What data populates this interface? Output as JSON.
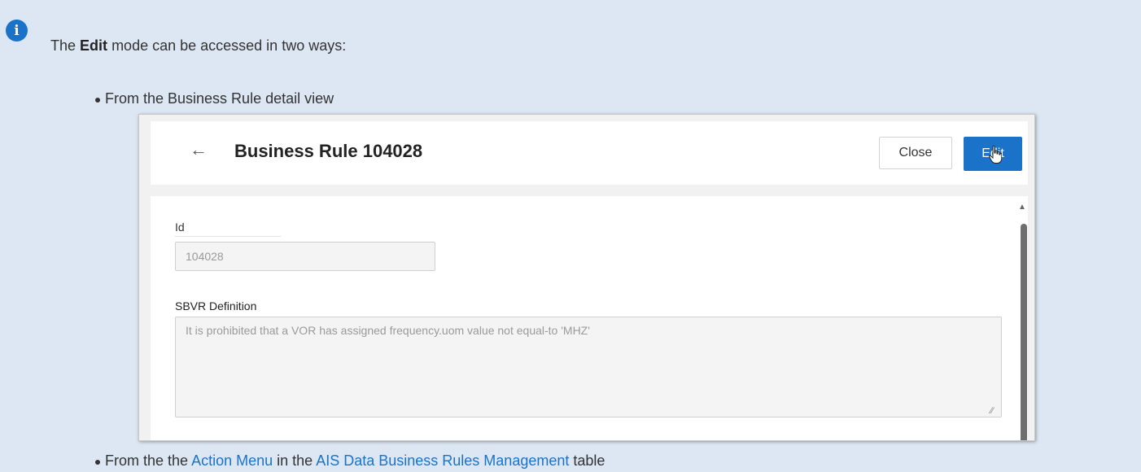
{
  "note": {
    "icon": "info-icon",
    "intro_prefix": "The",
    "intro_bold": "Edit",
    "intro_suffix": "mode can be accessed in two ways:"
  },
  "bullets": [
    {
      "text": "From the Business Rule detail view"
    },
    {
      "text_before": "From the the",
      "link1": "Action Menu",
      "text_middle": "in the",
      "link2": "AIS Data Business Rules Management",
      "text_after": "table"
    }
  ],
  "screenshot": {
    "back_icon": "back-arrow-icon",
    "title": "Business Rule 104028",
    "close_label": "Close",
    "edit_label": "Edit",
    "cursor_icon": "hand-cursor-icon",
    "id_label": "Id",
    "id_value": "104028",
    "sbvr_label": "SBVR Definition",
    "sbvr_value": "It is prohibited that a VOR has assigned frequency.uom value not equal-to 'MHZ'"
  },
  "colors": {
    "accent": "#1a73c8",
    "background": "#dce7f3"
  }
}
